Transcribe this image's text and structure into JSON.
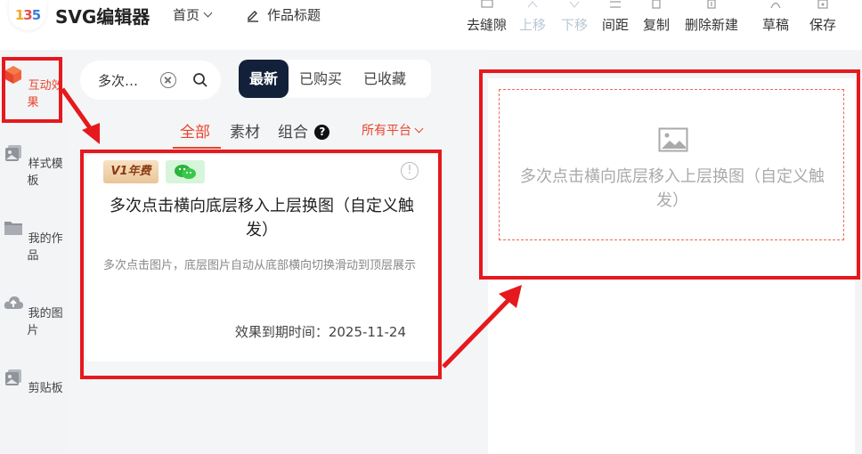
{
  "header": {
    "logo_text": "135",
    "app_title": "SVG编辑器",
    "home_label": "首页",
    "work_title_label": "作品标题",
    "tools": [
      {
        "label": "去缝隙",
        "icon": "gap-icon",
        "disabled": false
      },
      {
        "label": "上移",
        "icon": "move-up-icon",
        "disabled": true
      },
      {
        "label": "下移",
        "icon": "move-down-icon",
        "disabled": true
      },
      {
        "label": "间距",
        "icon": "spacing-icon",
        "disabled": false
      },
      {
        "label": "复制",
        "icon": "copy-icon",
        "disabled": false
      },
      {
        "label": "删除新建",
        "icon": "delete-new-icon",
        "disabled": false
      },
      {
        "label": "草稿",
        "icon": "draft-icon",
        "disabled": false
      },
      {
        "label": "保存",
        "icon": "save-icon",
        "disabled": false
      }
    ]
  },
  "sidebar": {
    "items": [
      {
        "label": "互动效果",
        "icon": "cube-icon",
        "active": true
      },
      {
        "label": "样式模板",
        "icon": "template-icon",
        "active": false
      },
      {
        "label": "我的作品",
        "icon": "folder-icon",
        "active": false
      },
      {
        "label": "我的图片",
        "icon": "cloud-upload-icon",
        "active": false
      },
      {
        "label": "剪贴板",
        "icon": "clipboard-icon",
        "active": false
      }
    ]
  },
  "search": {
    "value": "多次…"
  },
  "sort_tabs": [
    {
      "label": "最新",
      "active": true
    },
    {
      "label": "已购买",
      "active": false
    },
    {
      "label": "已收藏",
      "active": false
    }
  ],
  "filters": {
    "all": "全部",
    "material": "素材",
    "combo": "组合",
    "help": "?",
    "platform": "所有平台"
  },
  "card": {
    "vip_badge": "V1年费",
    "title": "多次点击横向底层移入上层换图（自定义触发）",
    "description": "多次点击图片，底层图片自动从底部横向切换滑动到顶层展示",
    "expiry": "效果到期时间：2025-11-24",
    "info": "!"
  },
  "canvas": {
    "placeholder": "多次点击横向底层移入上层换图（自定义触发）"
  },
  "colors": {
    "accent": "#e8442c",
    "annotation": "#e5191e",
    "dark_tab": "#13203a"
  }
}
